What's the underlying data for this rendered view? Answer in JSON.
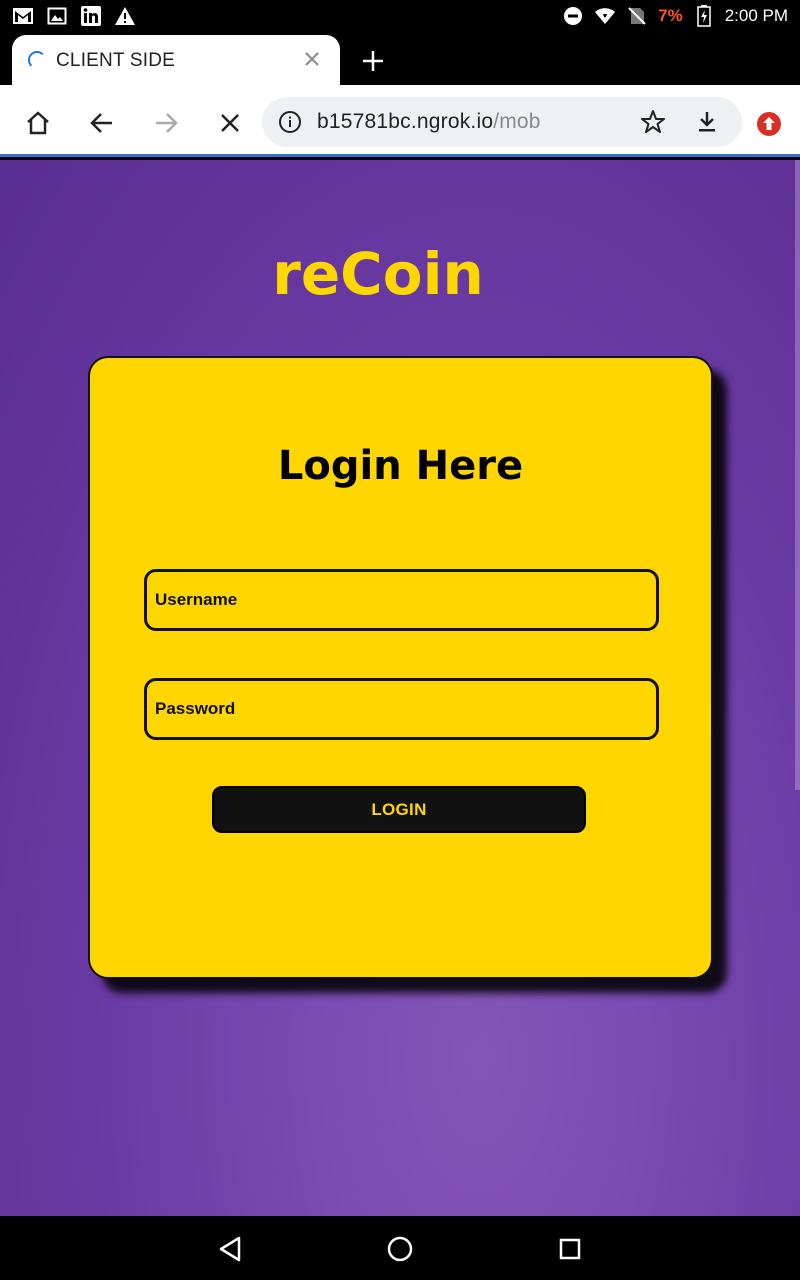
{
  "status_bar": {
    "icons_left": [
      "gmail-icon",
      "gallery-icon",
      "linkedin-icon",
      "warning-icon"
    ],
    "icons_right": [
      "do-not-disturb-icon",
      "wifi-icon",
      "no-sim-icon",
      "battery-charging-icon"
    ],
    "battery": "7%",
    "time": "2:00 PM"
  },
  "browser": {
    "tab_title": "CLIENT SIDE",
    "url_host": "b15781bc.ngrok.io",
    "url_path": "/mob"
  },
  "page": {
    "brand": "reCoin",
    "login_title": "Login Here",
    "username_placeholder": "Username",
    "password_placeholder": "Password",
    "login_button": "LOGIN"
  },
  "colors": {
    "accent_yellow": "#ffd600",
    "background_purple": "#6a3ba4",
    "button_dark": "#111111"
  }
}
